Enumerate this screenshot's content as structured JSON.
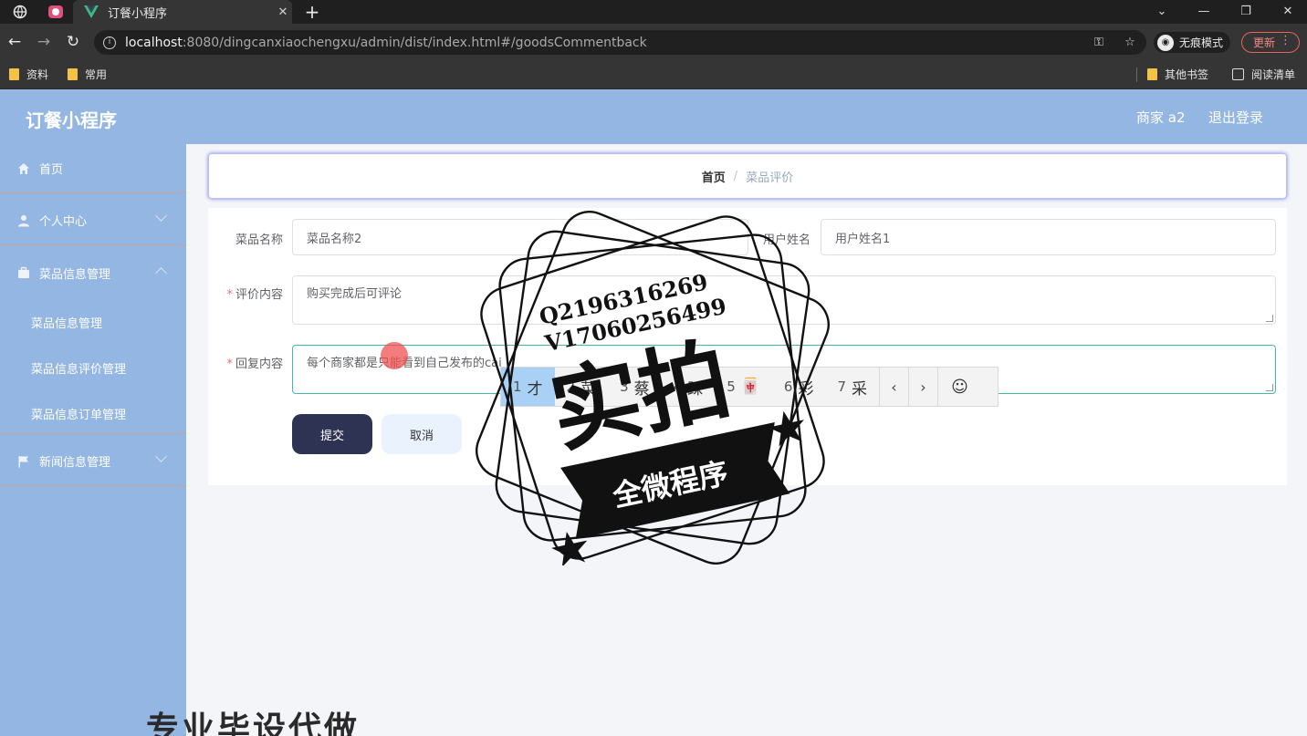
{
  "browser": {
    "tab_title": "订餐小程序",
    "url_host": "localhost",
    "url_rest": ":8080/dingcanxiaochengxu/admin/dist/index.html#/goodsCommentback",
    "incognito_label": "无痕模式",
    "update_label": "更新",
    "bookmarks": [
      "资料",
      "常用"
    ],
    "bookmarks_right": [
      "其他书签",
      "阅读清单"
    ]
  },
  "header": {
    "app_title": "订餐小程序",
    "user": "商家 a2",
    "logout": "退出登录"
  },
  "sidebar": {
    "items": [
      {
        "label": "首页",
        "icon": "home-icon"
      },
      {
        "label": "个人中心",
        "icon": "user-icon"
      },
      {
        "label": "菜品信息管理",
        "icon": "briefcase-icon"
      },
      {
        "label": "新闻信息管理",
        "icon": "flag-icon"
      }
    ],
    "submenu": [
      "菜品信息管理",
      "菜品信息评价管理",
      "菜品信息订单管理"
    ]
  },
  "breadcrumb": {
    "home": "首页",
    "separator": "/",
    "current": "菜品评价"
  },
  "form": {
    "dish_name_label": "菜品名称",
    "dish_name_value": "菜品名称2",
    "user_name_label": "用户姓名",
    "user_name_value": "用户姓名1",
    "comment_label": "评价内容",
    "comment_value": "购买完成后可评论",
    "reply_label": "回复内容",
    "reply_value": "每个商家都是只能看到自己发布的cai",
    "submit_label": "提交",
    "cancel_label": "取消"
  },
  "ime": {
    "candidates": [
      {
        "num": "1",
        "char": "才"
      },
      {
        "num": "2",
        "char": "菜"
      },
      {
        "num": "3",
        "char": "蔡"
      },
      {
        "num": "4",
        "char": "踩"
      },
      {
        "num": "5",
        "char": "🀄"
      },
      {
        "num": "6",
        "char": "彩"
      },
      {
        "num": "7",
        "char": "采"
      }
    ],
    "prev": "‹",
    "next": "›",
    "emoji": "☺"
  },
  "watermark": {
    "qq": "Q2196316269",
    "phone": "V17060256499",
    "big_text": "实拍",
    "ribbon": "全微程序",
    "bottom_text": "专业毕设代做"
  },
  "colors": {
    "header_bg": "#94b6e2",
    "submit_bg": "#2f3353",
    "required": "#f56c6c",
    "focus_border": "#3fb8ad"
  }
}
